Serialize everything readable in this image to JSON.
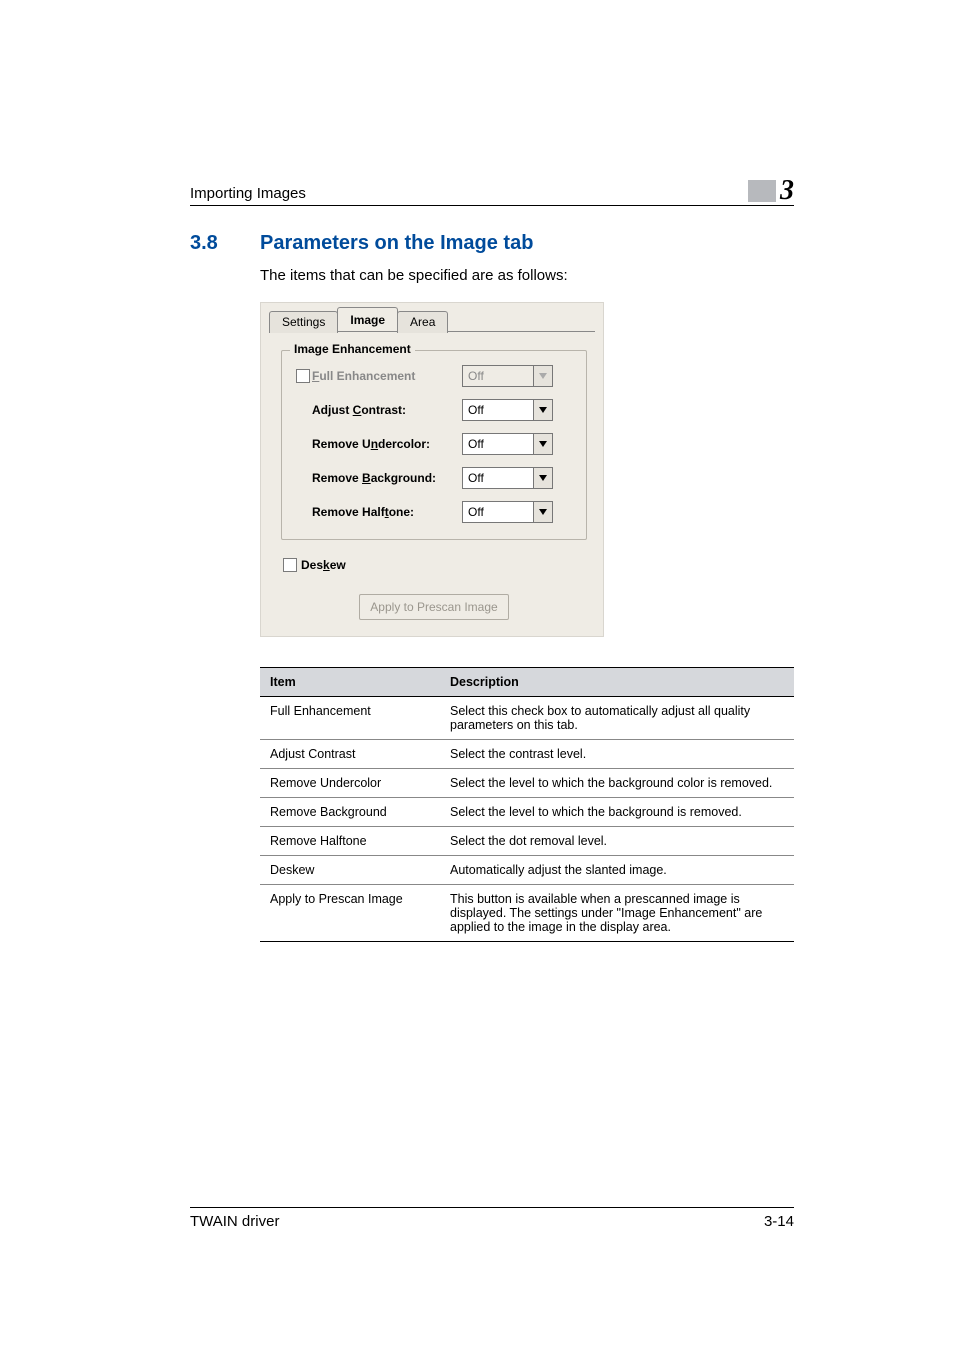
{
  "runhead": {
    "title": "Importing Images",
    "chapter": "3"
  },
  "section": {
    "num": "3.8",
    "title": "Parameters on the Image tab"
  },
  "intro": "The items that can be specified are as follows:",
  "panel": {
    "tabs": {
      "settings": "Settings",
      "image": "Image",
      "area": "Area"
    },
    "group_legend": "Image Enhancement",
    "rows": {
      "full": {
        "label_pre": "",
        "u": "F",
        "label_post": "ull Enhancement",
        "value": "Off"
      },
      "contrast": {
        "label_pre": "Adjust ",
        "u": "C",
        "label_post": "ontrast:",
        "value": "Off"
      },
      "undercolor": {
        "label_pre": "Remove U",
        "u": "n",
        "label_post": "dercolor:",
        "value": "Off"
      },
      "background": {
        "label_pre": "Remove ",
        "u": "B",
        "label_post": "ackground:",
        "value": "Off"
      },
      "halftone": {
        "label_pre": "Remove Half",
        "u": "t",
        "label_post": "one:",
        "value": "Off"
      }
    },
    "deskew": {
      "label_pre": "Des",
      "u": "k",
      "label_post": "ew"
    },
    "apply_btn": "Apply to Prescan Image"
  },
  "table": {
    "headers": {
      "item": "Item",
      "desc": "Description"
    },
    "rows": [
      {
        "item": "Full Enhancement",
        "desc": "Select this check box to automatically adjust all quality parameters on this tab."
      },
      {
        "item": "Adjust Contrast",
        "desc": "Select the contrast level."
      },
      {
        "item": "Remove Undercolor",
        "desc": "Select the level to which the background color is removed."
      },
      {
        "item": "Remove Background",
        "desc": "Select the level to which the background is removed."
      },
      {
        "item": "Remove Halftone",
        "desc": "Select the dot removal level."
      },
      {
        "item": "Deskew",
        "desc": "Automatically adjust the slanted image."
      },
      {
        "item": "Apply to Prescan Image",
        "desc": "This button is available when a prescanned image is displayed. The settings under \"Image Enhancement\" are applied to the image in the display area."
      }
    ]
  },
  "footer": {
    "left": "TWAIN driver",
    "right": "3-14"
  }
}
